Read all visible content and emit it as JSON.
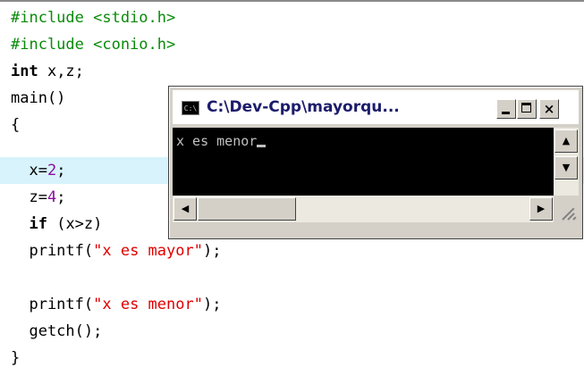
{
  "code": {
    "lines": [
      "#include <stdio.h>",
      "#include <conio.h>",
      "int x,z;",
      "main()",
      "{",
      "  x=2;",
      "  z=4;",
      "  if (x>z)",
      "  printf(\"x es mayor\");",
      "",
      "  printf(\"x es menor\");",
      "  getch();",
      "}"
    ],
    "highlight_color": "#d8f3fb"
  },
  "console": {
    "title": "C:\\Dev-Cpp\\mayorqu...",
    "icon": "console-icon",
    "icon_text": "C:\\",
    "output": "x es menor",
    "buttons": {
      "minimize": "minimize-icon",
      "maximize": "maximize-icon",
      "close_label": "×"
    },
    "scroll": {
      "up": "▲",
      "down": "▼",
      "left": "◀",
      "right": "▶"
    }
  }
}
